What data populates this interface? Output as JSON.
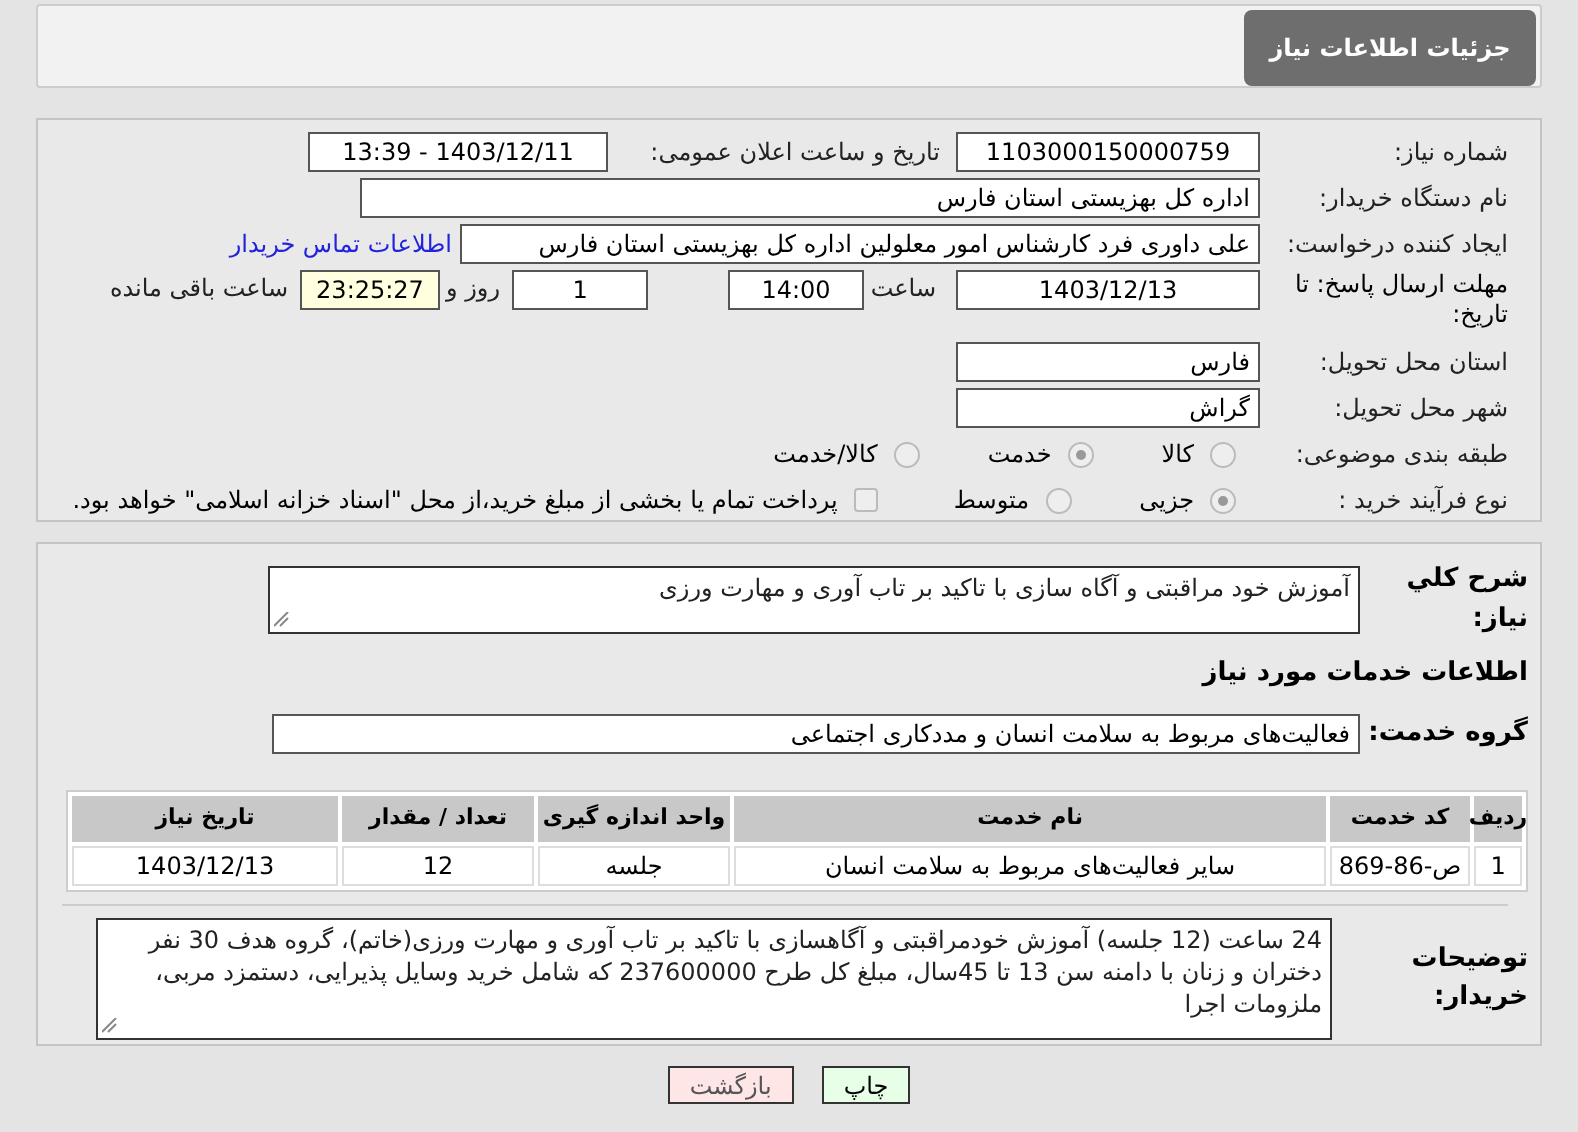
{
  "header": {
    "title": "جزئیات اطلاعات نیاز"
  },
  "details": {
    "need_number": {
      "label": "شماره نیاز:",
      "value": "1103000150000759"
    },
    "announce": {
      "label": "تاریخ و ساعت اعلان عمومی:",
      "value": "1403/12/11 - 13:39"
    },
    "buyer": {
      "label": "نام دستگاه خریدار:",
      "value": "اداره کل بهزیستی استان فارس"
    },
    "requester": {
      "label": "ایجاد کننده درخواست:",
      "value": "علی داوری فرد کارشناس امور معلولین اداره کل بهزیستی استان فارس",
      "link": "اطلاعات تماس خریدار"
    },
    "deadline": {
      "label": "مهلت ارسال پاسخ: تا تاریخ:",
      "date": "1403/12/13",
      "time_label": "ساعت",
      "time": "14:00",
      "days": "1",
      "days_label": "روز و",
      "remaining": "23:25:27",
      "remaining_label": "ساعت باقی مانده"
    },
    "province": {
      "label": "استان محل تحویل:",
      "value": "فارس"
    },
    "city": {
      "label": "شهر محل تحویل:",
      "value": "گراش"
    },
    "category": {
      "label": "طبقه بندی موضوعی:",
      "options": [
        {
          "label": "کالا",
          "selected": false
        },
        {
          "label": "خدمت",
          "selected": true
        },
        {
          "label": "کالا/خدمت",
          "selected": false
        }
      ]
    },
    "process": {
      "label": "نوع فرآیند خرید :",
      "options": [
        {
          "label": "جزیی",
          "selected": true
        },
        {
          "label": "متوسط",
          "selected": false
        }
      ],
      "payment": {
        "label": "پرداخت تمام یا بخشی از مبلغ خرید،از محل \"اسناد خزانه اسلامی\" خواهد بود.",
        "checked": false
      }
    }
  },
  "summary": {
    "label": "شرح کلي نياز:",
    "value": "آموزش خود مراقبتی و آگاه سازی با تاکید بر تاب آوری و مهارت ورزی"
  },
  "services_heading": "اطلاعات خدمات مورد نیاز",
  "service_group": {
    "label": "گروه خدمت:",
    "value": "فعالیت‌های مربوط به سلامت انسان و مددکاری اجتماعی"
  },
  "table": {
    "columns": [
      "ردیف",
      "کد خدمت",
      "نام خدمت",
      "واحد اندازه گیری",
      "تعداد / مقدار",
      "تاریخ نیاز"
    ],
    "rows": [
      [
        "1",
        "ص-86-869",
        "سایر فعالیت‌های مربوط به سلامت انسان",
        "جلسه",
        "12",
        "1403/12/13"
      ]
    ]
  },
  "buyer_notes": {
    "label": "توضیحات خریدار:",
    "value": "24 ساعت (12 جلسه) آموزش خودمراقبتی و آگاهسازی با تاکید بر تاب آوری و مهارت ورزی(خاتم)، گروه هدف 30 نفر دختران و زنان با دامنه سن 13 تا 45سال، مبلغ کل طرح 237600000 که شامل خرید وسایل پذیرایی، دستمزد مربی، ملزومات اجرا"
  },
  "buttons": [
    {
      "label": "چاپ",
      "kind": "print"
    },
    {
      "label": "بازگشت",
      "kind": "back"
    }
  ]
}
